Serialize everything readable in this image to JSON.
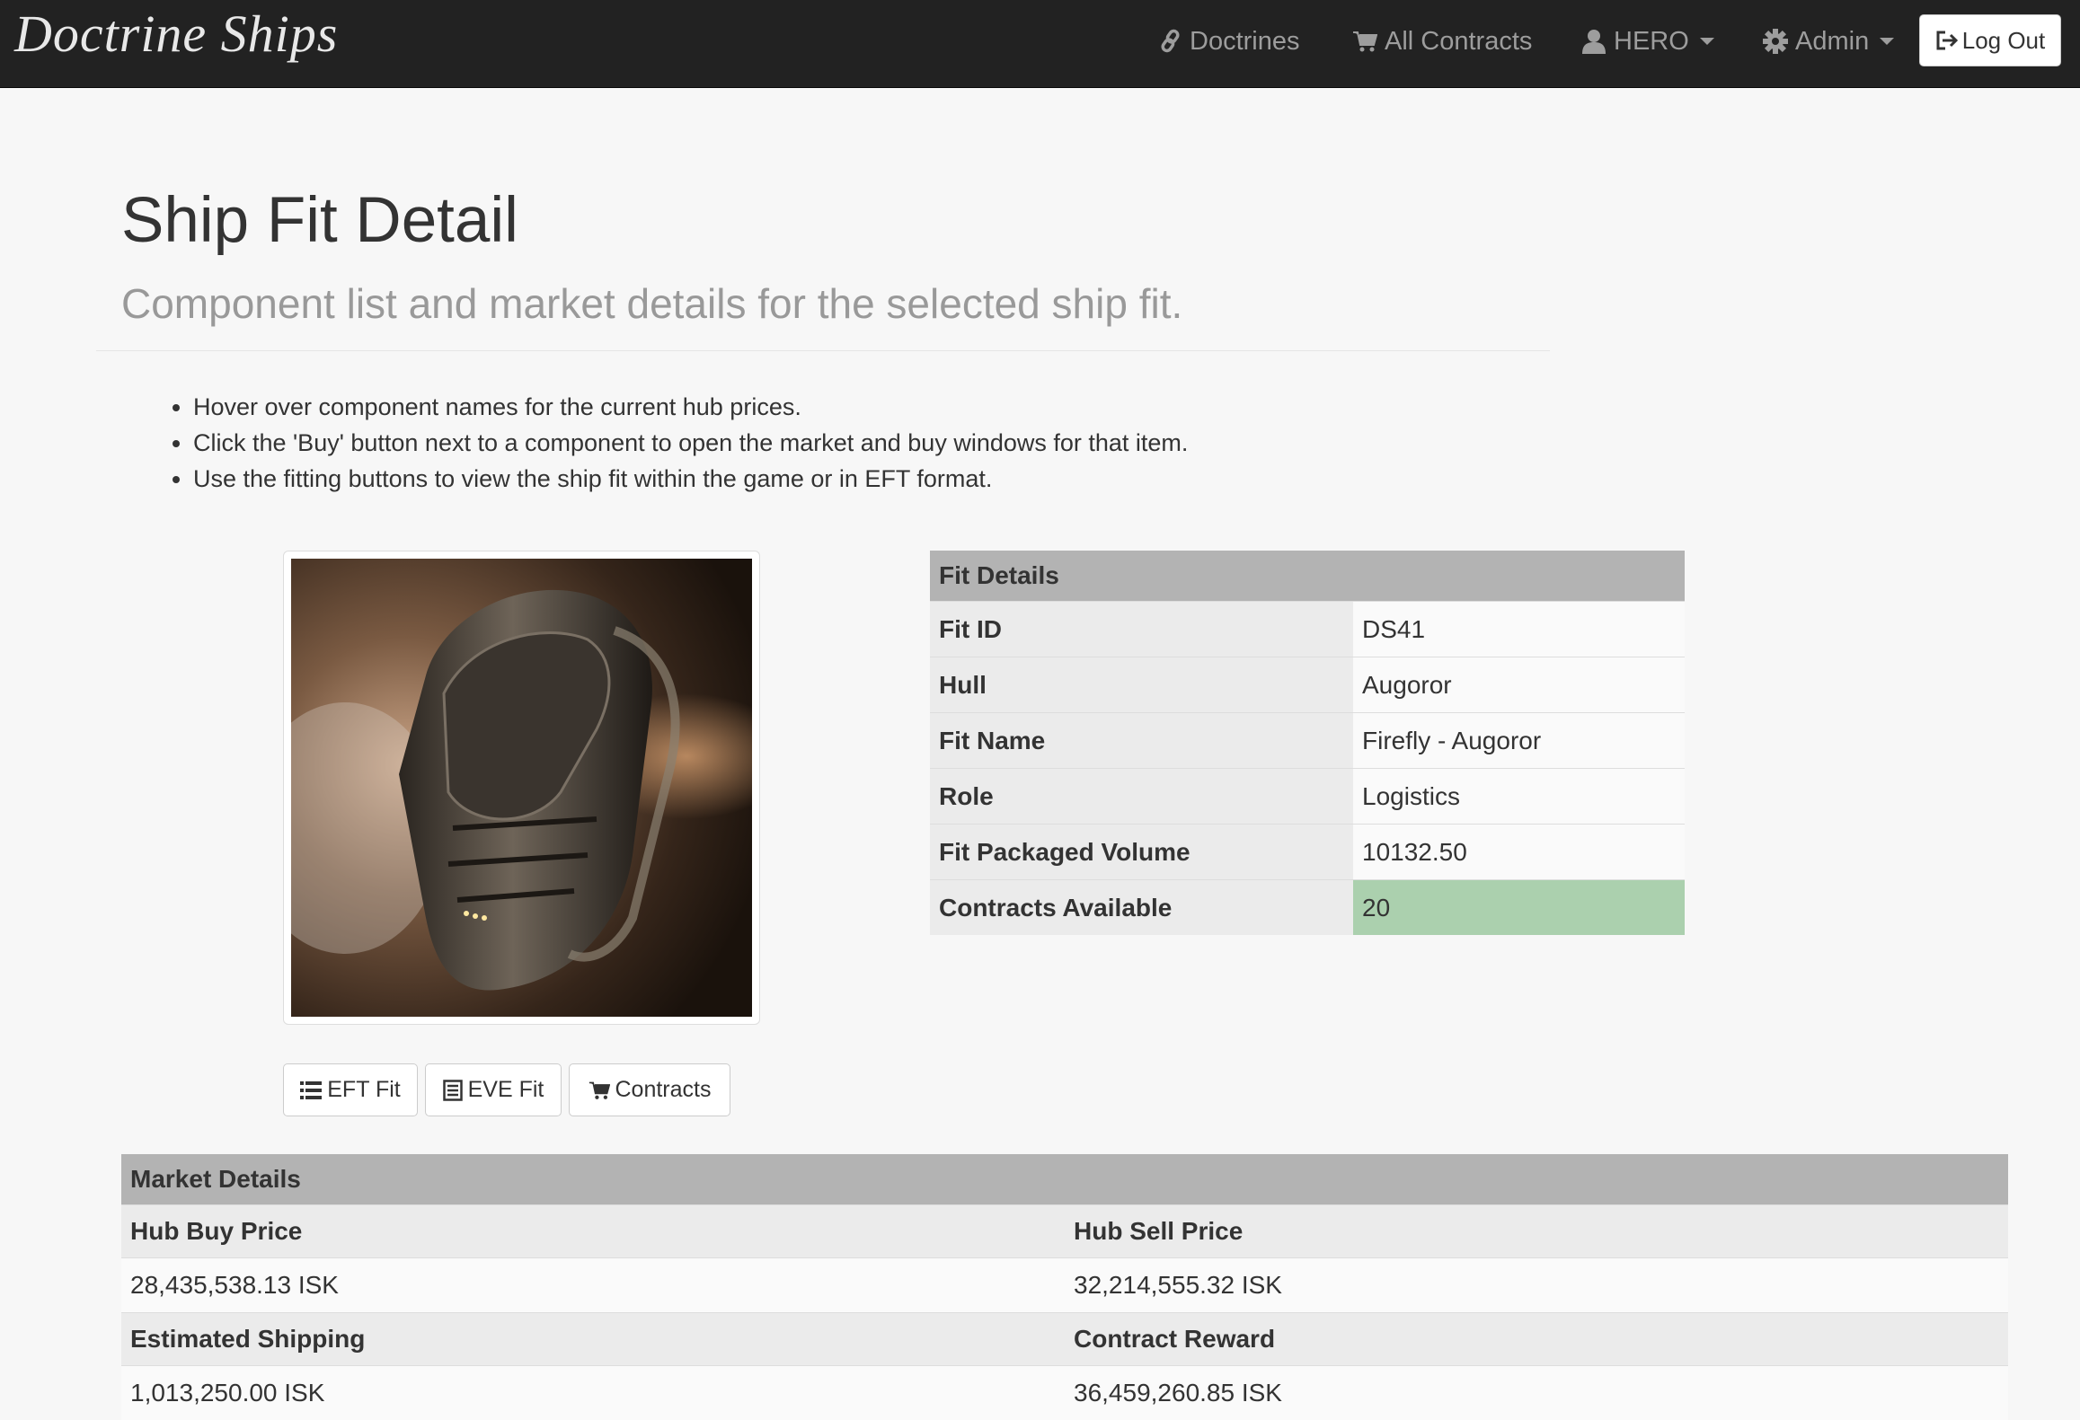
{
  "navbar": {
    "brand": "Doctrine Ships",
    "items": [
      {
        "label": "Doctrines",
        "icon": "link-icon"
      },
      {
        "label": "All Contracts",
        "icon": "cart-icon"
      },
      {
        "label": "HERO",
        "icon": "user-icon",
        "dropdown": true
      },
      {
        "label": "Admin",
        "icon": "gear-icon",
        "dropdown": true
      }
    ],
    "logout_label": "Log Out"
  },
  "header": {
    "title": "Ship Fit Detail",
    "subtitle": "Component list and market details for the selected ship fit."
  },
  "instructions": [
    "Hover over component names for the current hub prices.",
    "Click the 'Buy' button next to a component to open the market and buy windows for that item.",
    "Use the fitting buttons to view the ship fit within the game or in EFT format."
  ],
  "buttons": {
    "eft": "EFT Fit",
    "eve": "EVE Fit",
    "contracts": "Contracts"
  },
  "fit_details": {
    "heading": "Fit Details",
    "rows": [
      {
        "label": "Fit ID",
        "value": "DS41"
      },
      {
        "label": "Hull",
        "value": "Augoror"
      },
      {
        "label": "Fit Name",
        "value": "Firefly - Augoror"
      },
      {
        "label": "Role",
        "value": "Logistics"
      },
      {
        "label": "Fit Packaged Volume",
        "value": "10132.50"
      },
      {
        "label": "Contracts Available",
        "value": "20"
      }
    ]
  },
  "market_details": {
    "heading": "Market Details",
    "hub_buy_label": "Hub Buy Price",
    "hub_sell_label": "Hub Sell Price",
    "hub_buy_value": "28,435,538.13 ISK",
    "hub_sell_value": "32,214,555.32 ISK",
    "shipping_label": "Estimated Shipping",
    "reward_label": "Contract Reward",
    "shipping_value": "1,013,250.00 ISK",
    "reward_value": "36,459,260.85 ISK"
  },
  "colors": {
    "navbar_bg": "#222222",
    "table_header": "#b3b3b3",
    "success": "#abd0ae"
  }
}
